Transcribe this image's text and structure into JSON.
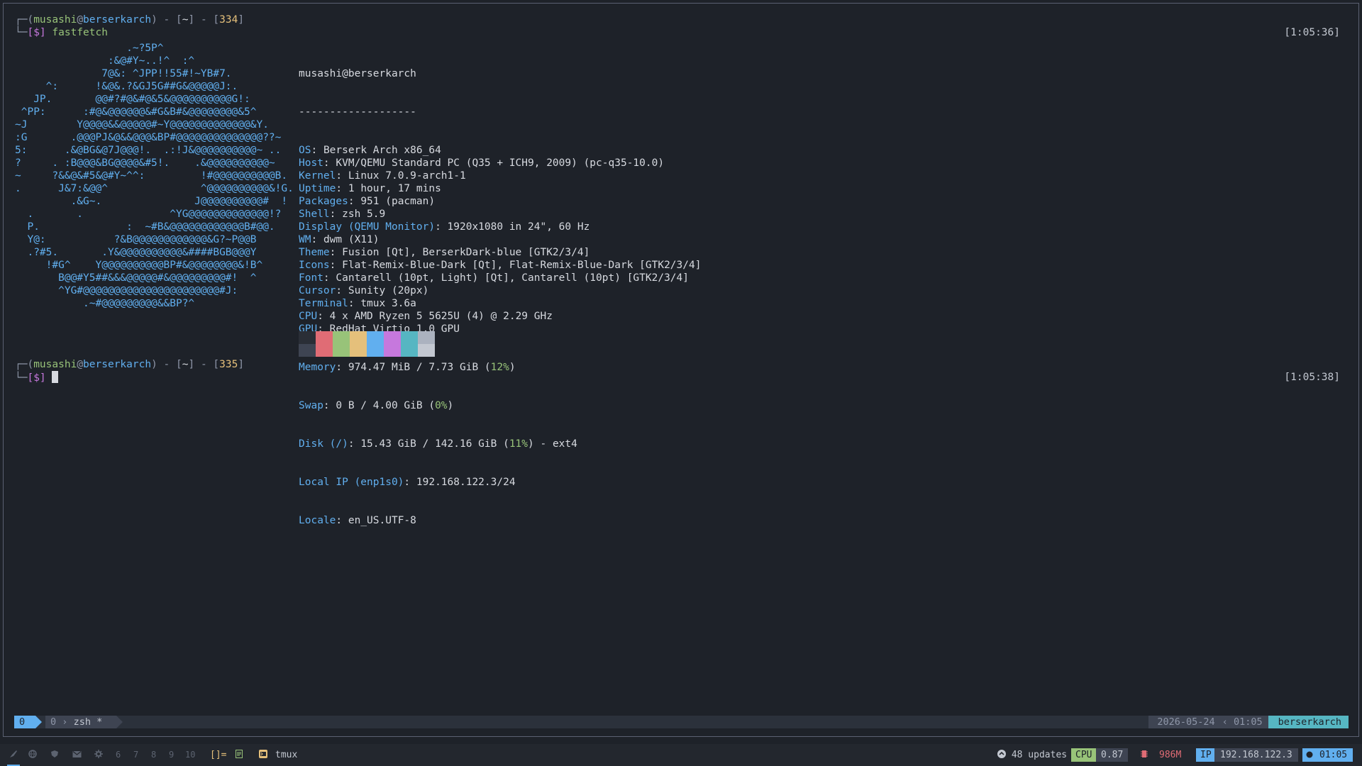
{
  "prompt1": {
    "corner_top": "┌─",
    "corner_bottom": "└─",
    "paren_open": "(",
    "user": "musashi",
    "at": "@",
    "host": "berserkarch",
    "paren_close": ")",
    "dash1": " - ",
    "dir_open": "[",
    "dir": "~",
    "dir_close": "]",
    "dash2": " - ",
    "num_open": "[",
    "num": "334",
    "num_close": "]",
    "symbol": "[$]",
    "command": "fastfetch",
    "time": "[1:05:36]"
  },
  "prompt2": {
    "num": "335",
    "time": "[1:05:38]"
  },
  "logo_lines": [
    "                  .~?5P^",
    "               :&@#Y~..!^  :^",
    "              7@&: ^JPP!!55#!~YB#7.",
    "     ^:      !&@&.?&GJ5G##G&@@@@@J:.",
    "   JP.       @@#?#@&#@&5&@@@@@@@@@@G!:",
    " ^PP:      :#@&@@@@@@&#G&B#&@@@@@@@@&5^",
    "~J        Y@@@@&&@@@@@#~Y@@@@@@@@@@@@@&Y.",
    ":G       .@@@PJ&@&&@@@&BP#@@@@@@@@@@@@@@??~",
    "5:      .&@BG&@7J@@@!.  .:!J&@@@@@@@@@@~ ..",
    "?     . :B@@@&BG@@@@&#5!.    .&@@@@@@@@@@~",
    "~     ?&&@&#5&@#Y~^^:         !#@@@@@@@@@@B.",
    ".      J&7:&@@^               ^@@@@@@@@@@&!G.",
    "         .&G~.               J@@@@@@@@@@#  !",
    "  .       .              ^YG@@@@@@@@@@@@@!?",
    "  P.              :  ~#B&@@@@@@@@@@@@B#@@.",
    "  Y@:           ?&B@@@@@@@@@@@@&G?~P@@B",
    "  .?#5.       .Y&@@@@@@@@@@&####BGB@@@Y",
    "     !#G^    Y@@@@@@@@@@BP#&@@@@@@@@&!B^",
    "       B@@#Y5##&&&@@@@@#&@@@@@@@@@#!  ^",
    "       ^YG#@@@@@@@@@@@@@@@@@@@@@@#J:",
    "           .~#@@@@@@@@@&&BP?^"
  ],
  "info": {
    "title": "musashi@berserkarch",
    "separator": "-------------------",
    "rows": [
      {
        "key": "OS",
        "sep": ": ",
        "value": "Berserk Arch x86_64"
      },
      {
        "key": "Host",
        "sep": ": ",
        "value": "KVM/QEMU Standard PC (Q35 + ICH9, 2009) (pc-q35-10.0)"
      },
      {
        "key": "Kernel",
        "sep": ": ",
        "value": "Linux 7.0.9-arch1-1"
      },
      {
        "key": "Uptime",
        "sep": ": ",
        "value": "1 hour, 17 mins"
      },
      {
        "key": "Packages",
        "sep": ": ",
        "value": "951 (pacman)"
      },
      {
        "key": "Shell",
        "sep": ": ",
        "value": "zsh 5.9"
      },
      {
        "key": "Display (QEMU Monitor)",
        "sep": ": ",
        "value": "1920x1080 in 24\", 60 Hz"
      },
      {
        "key": "WM",
        "sep": ": ",
        "value": "dwm (X11)"
      },
      {
        "key": "Theme",
        "sep": ": ",
        "value": "Fusion [Qt], BerserkDark-blue [GTK2/3/4]"
      },
      {
        "key": "Icons",
        "sep": ": ",
        "value": "Flat-Remix-Blue-Dark [Qt], Flat-Remix-Blue-Dark [GTK2/3/4]"
      },
      {
        "key": "Font",
        "sep": ": ",
        "value": "Cantarell (10pt, Light) [Qt], Cantarell (10pt) [GTK2/3/4]"
      },
      {
        "key": "Cursor",
        "sep": ": ",
        "value": "Sunity (20px)"
      },
      {
        "key": "Terminal",
        "sep": ": ",
        "value": "tmux 3.6a"
      },
      {
        "key": "CPU",
        "sep": ": ",
        "value": "4 x AMD Ryzen 5 5625U (4) @ 2.29 GHz"
      },
      {
        "key": "GPU",
        "sep": ": ",
        "value": "RedHat Virtio 1.0 GPU"
      }
    ],
    "memory": {
      "key": "Memory",
      "value": "974.47 MiB / 7.73 GiB (",
      "pct": "12%",
      "tail": ")"
    },
    "swap": {
      "key": "Swap",
      "value": "0 B / 4.00 GiB (",
      "pct": "0%",
      "tail": ")"
    },
    "disk": {
      "key": "Disk (/)",
      "value": "15.43 GiB / 142.16 GiB (",
      "pct": "11%",
      "tail": ") - ext4"
    },
    "local_ip": {
      "key": "Local IP (enp1s0)",
      "value": "192.168.122.3/24"
    },
    "locale": {
      "key": "Locale",
      "value": "en_US.UTF-8"
    }
  },
  "palette": {
    "top": [
      "#2a2e36",
      "#e06c75",
      "#98c379",
      "#e5c07b",
      "#61afef",
      "#c678dd",
      "#56b6c2",
      "#abb2bf"
    ],
    "bottom": [
      "#3e4452",
      "#e06c75",
      "#98c379",
      "#e5c07b",
      "#61afef",
      "#c678dd",
      "#56b6c2",
      "#c3c8d1"
    ]
  },
  "tmux": {
    "session": "0",
    "window_index": "0",
    "window_name": "zsh",
    "window_flag": "*",
    "date": "2026-05-24",
    "time": "01:05",
    "host": "berserkarch"
  },
  "bar": {
    "workspaces": [
      {
        "label": "6"
      },
      {
        "label": "7"
      },
      {
        "label": "8"
      },
      {
        "label": "9"
      },
      {
        "label": "10"
      }
    ],
    "layout": "[]=",
    "tmux_label": "tmux",
    "updates": "48 updates",
    "cpu_tag": "CPU",
    "cpu_value": "0.87",
    "mem_value": "986M",
    "ip_tag": "IP",
    "ip_value": "192.168.122.3",
    "clock": "01:05"
  }
}
